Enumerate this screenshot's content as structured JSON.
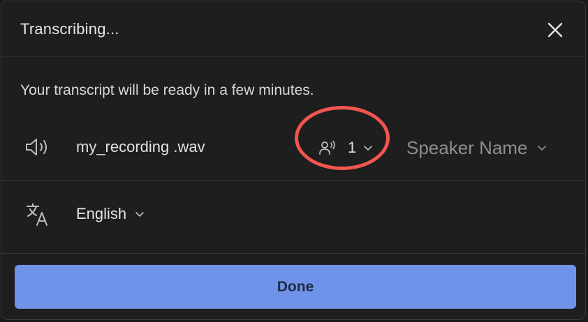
{
  "dialog": {
    "title": "Transcribing...",
    "close_icon": "close-icon"
  },
  "message": "Your transcript will be ready in a few minutes.",
  "file": {
    "icon": "speaker-icon",
    "name": "my_recording .wav"
  },
  "speakers": {
    "icon": "people-voice-icon",
    "count": "1",
    "highlight_color": "#f2564f"
  },
  "speaker_name": {
    "label": "Speaker Name"
  },
  "language": {
    "icon": "translate-icon",
    "selected": "English"
  },
  "actions": {
    "done_label": "Done",
    "done_color": "#6f93e8"
  }
}
